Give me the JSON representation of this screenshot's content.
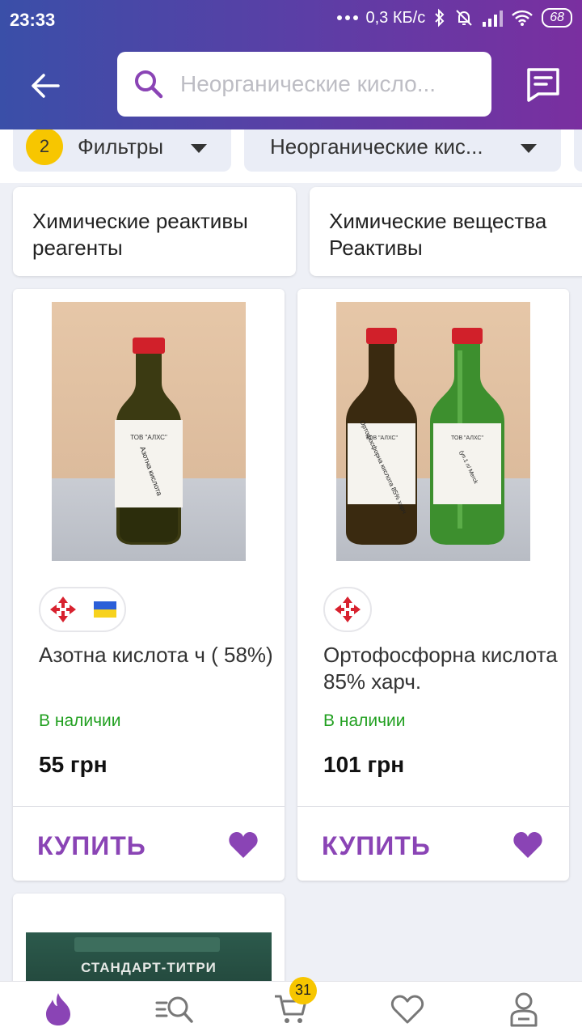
{
  "status_bar": {
    "time": "23:33",
    "network_speed": "0,3 КБ/с",
    "battery": "68"
  },
  "header": {
    "back_icon": "arrow-left-icon",
    "search_placeholder": "Неорганические кисло...",
    "chat_icon": "chat-icon"
  },
  "filters": {
    "count": "2",
    "label": "Фильтры",
    "category_label": "Неорганические кис..."
  },
  "categories": [
    {
      "label": "Химические реактивы реагенты"
    },
    {
      "label": "Химические вещества Реактивы"
    }
  ],
  "products": [
    {
      "title": "Азотна кислота ч ( 58%)",
      "availability": "В наличии",
      "price": "55 грн",
      "buy_label": "КУПИТЬ",
      "badges": [
        "nova-poshta-icon",
        "ukraine-flag-icon"
      ],
      "bottle_labels": [
        "ТОВ \"АЛХС\"",
        "Азотна кислота"
      ]
    },
    {
      "title": "Ортофосфорна кислота 85% харч.",
      "availability": "В наличии",
      "price": "101 грн",
      "buy_label": "КУПИТЬ",
      "badges": [
        "nova-poshta-icon"
      ],
      "bottle_labels": [
        "ТОВ \"АЛХС\"",
        "Ортофосфорна кислота 85% харч",
        "(уп.1 л/ Merck"
      ]
    },
    {
      "image_text": "СТАНДАРТ-ТИТРИ"
    }
  ],
  "bottom_nav": {
    "items": [
      "home-flame-icon",
      "catalog-search-icon",
      "cart-icon",
      "favorites-icon",
      "profile-icon"
    ],
    "cart_count": "31"
  },
  "colors": {
    "header_start": "#3a4fa8",
    "header_end": "#7a2fa0",
    "accent_purple": "#8a44b5",
    "in_stock_green": "#22a021",
    "badge_yellow": "#f7c600"
  }
}
